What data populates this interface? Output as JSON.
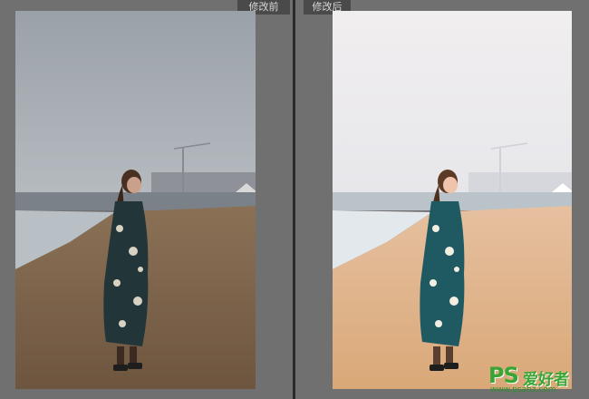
{
  "panels": {
    "before": {
      "label": "修改前"
    },
    "after": {
      "label": "修改后"
    }
  },
  "watermark": {
    "logo": "PS",
    "name": "爱好者",
    "url": "www.psahz.com"
  },
  "colors": {
    "background": "#707070",
    "divider": "#2b2b2b",
    "tab_bg": "#4a4a4a",
    "watermark_green": "#3aa535"
  }
}
